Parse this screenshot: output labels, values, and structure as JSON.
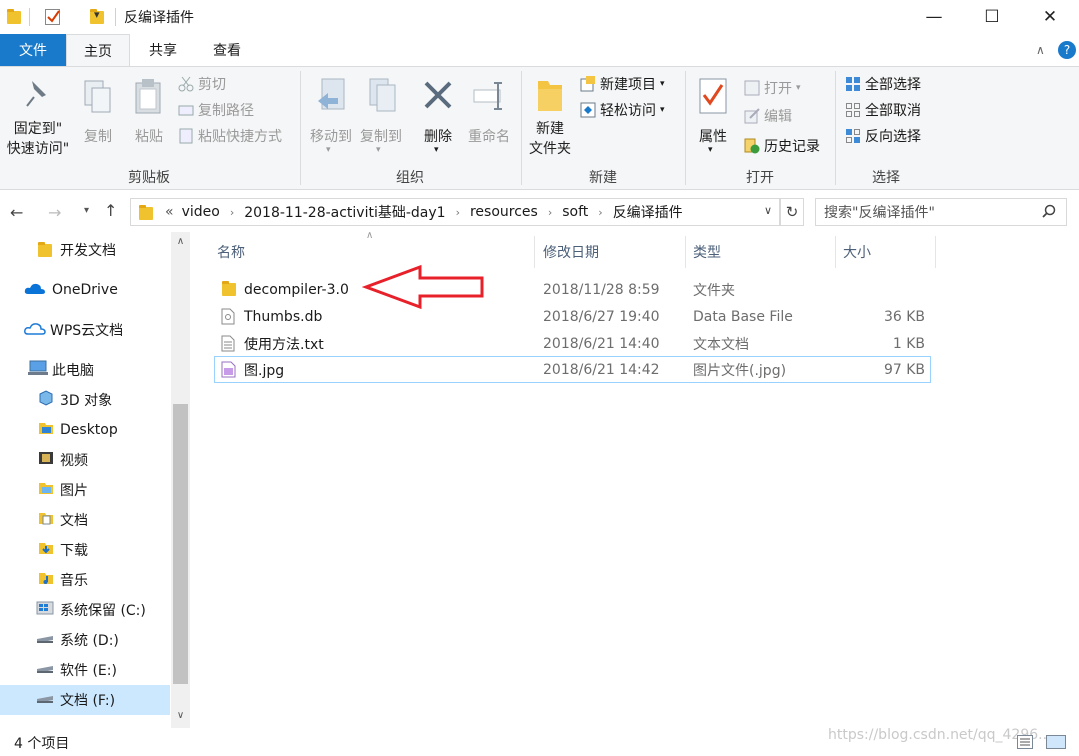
{
  "window": {
    "title": "反编译插件",
    "minimize": "—",
    "maximize": "☐",
    "close": "✕"
  },
  "ribbon_tabs": {
    "file": "文件",
    "home": "主页",
    "share": "共享",
    "view": "查看",
    "help": "?"
  },
  "clipboard": {
    "pin": "固定到\"快速访问\"",
    "pin_line1": "固定到\"",
    "pin_line2": "快速访问\"",
    "copy": "复制",
    "paste": "粘贴",
    "cut": "剪切",
    "copy_path": "复制路径",
    "paste_shortcut": "粘贴快捷方式",
    "label": "剪贴板"
  },
  "organize": {
    "move_to": "移动到",
    "copy_to": "复制到",
    "delete": "删除",
    "rename": "重命名",
    "label": "组织"
  },
  "new_group": {
    "new_item": "新建项目",
    "easy_access": "轻松访问",
    "new_folder_line1": "新建",
    "new_folder_line2": "文件夹",
    "label": "新建"
  },
  "open_group": {
    "properties": "属性",
    "open": "打开",
    "edit": "编辑",
    "history": "历史记录",
    "label": "打开"
  },
  "select_group": {
    "select_all": "全部选择",
    "select_none": "全部取消",
    "invert": "反向选择",
    "label": "选择"
  },
  "address": {
    "prefix": "«",
    "crumbs": [
      "video",
      "2018-11-28-activiti基础-day1",
      "resources",
      "soft",
      "反编译插件"
    ],
    "search_placeholder": "搜索\"反编译插件\""
  },
  "nav_pane": [
    {
      "label": "开发文档",
      "icon": "folder-icon"
    },
    {
      "label": "OneDrive",
      "icon": "onedrive-icon"
    },
    {
      "label": "WPS云文档",
      "icon": "wps-cloud-icon"
    },
    {
      "label": "此电脑",
      "icon": "this-pc-icon"
    },
    {
      "label": "3D 对象",
      "icon": "3d-objects-icon"
    },
    {
      "label": "Desktop",
      "icon": "desktop-folder-icon"
    },
    {
      "label": "视频",
      "icon": "videos-icon"
    },
    {
      "label": "图片",
      "icon": "pictures-icon"
    },
    {
      "label": "文档",
      "icon": "documents-icon"
    },
    {
      "label": "下载",
      "icon": "downloads-icon"
    },
    {
      "label": "音乐",
      "icon": "music-icon"
    },
    {
      "label": "系统保留 (C:)",
      "icon": "windows-drive-icon"
    },
    {
      "label": "系统 (D:)",
      "icon": "drive-icon"
    },
    {
      "label": "软件 (E:)",
      "icon": "drive-icon"
    },
    {
      "label": "文档 (F:)",
      "icon": "drive-icon"
    }
  ],
  "columns": {
    "name": "名称",
    "modified": "修改日期",
    "type": "类型",
    "size": "大小"
  },
  "files": [
    {
      "name": "decompiler-3.0",
      "modified": "2018/11/28 8:59",
      "type": "文件夹",
      "size": "",
      "icon": "folder-icon"
    },
    {
      "name": "Thumbs.db",
      "modified": "2018/6/27 19:40",
      "type": "Data Base File",
      "size": "36 KB",
      "icon": "db-file-icon"
    },
    {
      "name": "使用方法.txt",
      "modified": "2018/6/21 14:40",
      "type": "文本文档",
      "size": "1 KB",
      "icon": "text-file-icon"
    },
    {
      "name": "图.jpg",
      "modified": "2018/6/21 14:42",
      "type": "图片文件(.jpg)",
      "size": "97 KB",
      "icon": "image-file-icon"
    }
  ],
  "status": {
    "item_count": "4 个项目"
  },
  "watermark": "https://blog.csdn.net/qq_4296...",
  "colors": {
    "accent": "#1979ca",
    "selection_border": "#99d1ff",
    "annotation_arrow": "#e8202a",
    "nav_selected": "#cce8ff"
  }
}
